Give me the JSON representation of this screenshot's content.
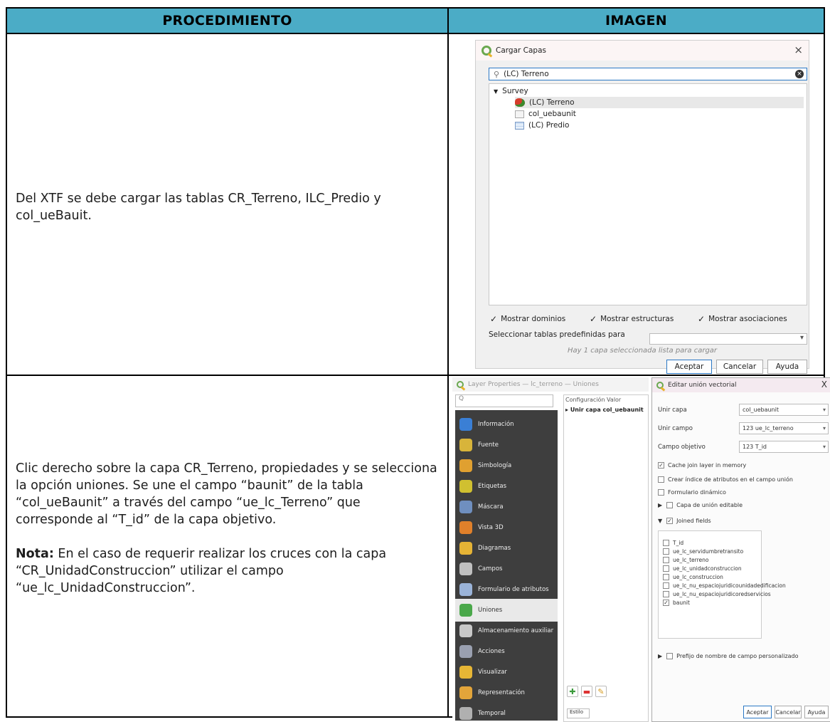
{
  "headers": {
    "procedure": "PROCEDIMIENTO",
    "image": "IMAGEN"
  },
  "colors": {
    "header_bg": "#4bacc6",
    "border": "#000000",
    "qgis_green": "#6aa84f",
    "dark_nav": "#3e3e3e"
  },
  "rows": [
    {
      "text": "Del XTF se debe cargar las tablas CR_Terreno, ILC_Predio y col_ueBauit."
    },
    {
      "text": "Clic derecho sobre la capa CR_Terreno, propiedades y se selecciona la opción uniones. Se une el campo “baunit” de la tabla “col_ueBaunit” a través del campo “ue_lc_Terreno” que corresponde al “T_id” de la capa objetivo.",
      "note_label": "Nota:",
      "note_text": " En el caso de requerir realizar los cruces con la capa “CR_UnidadConstruccion” utilizar el campo “ue_lc_UnidadConstruccion”."
    }
  ],
  "load_dialog": {
    "title": "Cargar Capas",
    "close": "×",
    "search": "(LC) Terreno",
    "tree": [
      {
        "label": "Survey",
        "icon": "caret-down-icon"
      },
      {
        "label": "(LC) Terreno",
        "icon": "polygon-layer-icon"
      },
      {
        "label": "col_uebaunit",
        "icon": "relation-table-icon"
      },
      {
        "label": "(LC) Predio",
        "icon": "table-icon"
      }
    ],
    "checks": [
      "Mostrar dominios",
      "Mostrar estructuras",
      "Mostrar asociaciones"
    ],
    "predefined_label": "Seleccionar tablas predefinidas para",
    "note": "Hay 1 capa seleccionada lista para cargar",
    "buttons": [
      "Aceptar",
      "Cancelar",
      "Ayuda"
    ]
  },
  "layer_props": {
    "title": "Layer Properties — lc_terreno — Uniones",
    "search": "Q",
    "columns": "Configuración  Valor",
    "join_row": "Unir capa col_uebaunit",
    "mode": "Estilo",
    "nav": [
      {
        "label": "Información",
        "color": "#3a7fd5"
      },
      {
        "label": "Fuente",
        "color": "#d8b43a"
      },
      {
        "label": "Simbología",
        "color": "#e0a030"
      },
      {
        "label": "Etiquetas",
        "color": "#d0c030"
      },
      {
        "label": "Máscara",
        "color": "#6f8fbf"
      },
      {
        "label": "Vista 3D",
        "color": "#e0802a"
      },
      {
        "label": "Diagramas",
        "color": "#e5b335"
      },
      {
        "label": "Campos",
        "color": "#c0c0c0"
      },
      {
        "label": "Formulario de atributos",
        "color": "#9ab3d8"
      },
      {
        "label": "Uniones",
        "color": "#4aa84a"
      },
      {
        "label": "Almacenamiento auxiliar",
        "color": "#c8c8c8"
      },
      {
        "label": "Acciones",
        "color": "#9aa0b0"
      },
      {
        "label": "Visualizar",
        "color": "#e7b635"
      },
      {
        "label": "Representación",
        "color": "#e3a53a"
      },
      {
        "label": "Temporal",
        "color": "#b0b0b0"
      }
    ]
  },
  "join_dialog": {
    "title": "Editar unión vectorial",
    "close": "X",
    "fields": [
      {
        "label": "Unir capa",
        "value": "col_uebaunit"
      },
      {
        "label": "Unir campo",
        "value": "123 ue_lc_terreno"
      },
      {
        "label": "Campo objetivo",
        "value": "123 T_id"
      }
    ],
    "options": [
      {
        "label": "Cache join layer in memory",
        "checked": true
      },
      {
        "label": "Crear índice de atributos en el campo unión",
        "checked": false
      },
      {
        "label": "Formulario dinámico",
        "checked": false
      },
      {
        "label": "Capa de unión editable",
        "checked": false
      },
      {
        "label": "Joined fields",
        "checked": true
      }
    ],
    "joined_fields": [
      {
        "label": "T_id",
        "checked": false
      },
      {
        "label": "ue_lc_servidumbretransito",
        "checked": false
      },
      {
        "label": "ue_lc_terreno",
        "checked": false
      },
      {
        "label": "ue_lc_unidadconstruccion",
        "checked": false
      },
      {
        "label": "ue_lc_construccion",
        "checked": false
      },
      {
        "label": "ue_lc_nu_espaciojuridicounidadedificacion",
        "checked": false
      },
      {
        "label": "ue_lc_nu_espaciojuridicoredservicios",
        "checked": false
      },
      {
        "label": "baunit",
        "checked": true
      }
    ],
    "prefix": "Prefijo de nombre de campo personalizado",
    "buttons": [
      "Aceptar",
      "Cancelar",
      "Ayuda"
    ]
  }
}
